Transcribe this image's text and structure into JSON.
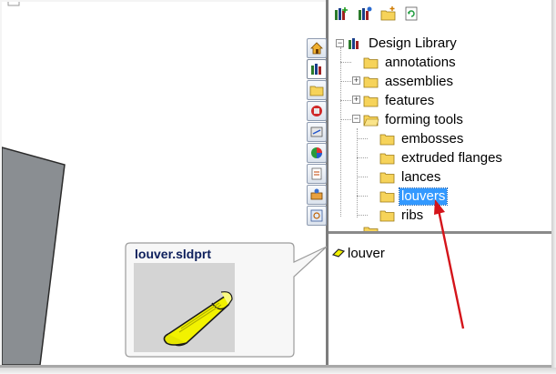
{
  "tree": {
    "root": "Design Library",
    "items": [
      {
        "label": "annotations"
      },
      {
        "label": "assemblies"
      },
      {
        "label": "features"
      },
      {
        "label": "forming tools"
      },
      {
        "label": "embosses"
      },
      {
        "label": "extruded flanges"
      },
      {
        "label": "lances"
      },
      {
        "label": "louvers"
      },
      {
        "label": "ribs"
      }
    ],
    "selected_item": "louvers"
  },
  "file_list": {
    "items": [
      {
        "label": "louver"
      }
    ]
  },
  "preview": {
    "title": "louver.sldprt"
  },
  "icons": {
    "toolbar": [
      "add-to-library-icon",
      "add-file-location-icon",
      "create-folder-icon",
      "refresh-icon"
    ],
    "side_tabs": [
      "home-icon",
      "design-library-icon",
      "file-explorer-icon",
      "view-palette-icon",
      "toolbox-icon",
      "appearances-icon",
      "custom-properties-icon",
      "3d-content-icon",
      "search-icon"
    ],
    "folder": "folder-icon",
    "part": "part-icon"
  },
  "colors": {
    "selection": "#3399ff",
    "annotation_arrow": "#d4141a",
    "part_yellow": "#f2f200"
  }
}
